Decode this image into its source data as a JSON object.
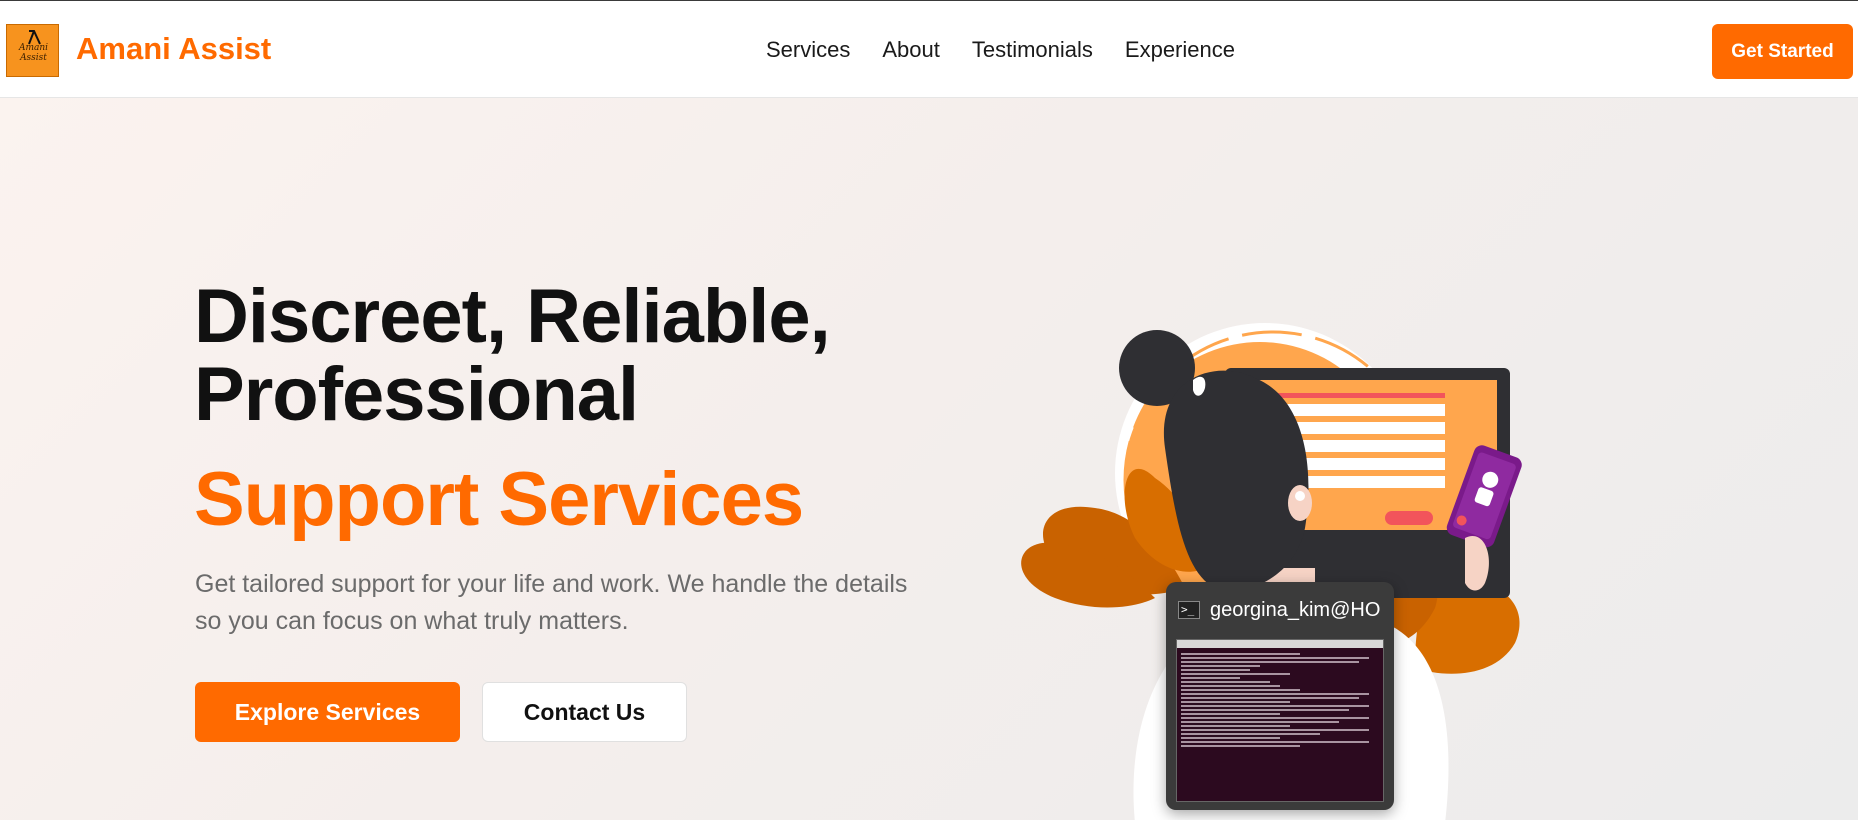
{
  "header": {
    "logo_text": "Amani Assist",
    "brand": "Amani Assist",
    "nav": [
      "Services",
      "About",
      "Testimonials",
      "Experience"
    ],
    "cta": "Get Started"
  },
  "hero": {
    "title_line1": "Discreet, Reliable,",
    "title_line2": "Professional",
    "title_highlight": "Support Services",
    "subtitle": "Get tailored support for your life and work. We handle the details so you can focus on what truly matters.",
    "primary_button": "Explore Services",
    "secondary_button": "Contact Us"
  },
  "taskbar_preview": {
    "title": "georgina_kim@HO..."
  },
  "colors": {
    "accent": "#ff6a00",
    "text_dark": "#111111",
    "text_muted": "#6b6b6b"
  }
}
